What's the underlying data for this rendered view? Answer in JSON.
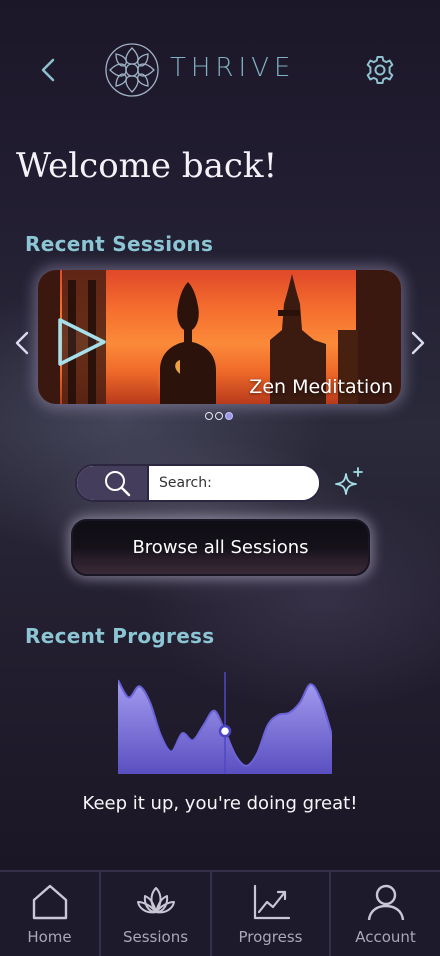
{
  "header": {
    "brand": "THRIVE",
    "back_icon": "chevron-left-icon",
    "logo_icon": "lotus-mandala-icon",
    "settings_icon": "gear-icon"
  },
  "welcome": {
    "title": "Welcome back!"
  },
  "recent_sessions": {
    "title": "Recent Sessions",
    "current": {
      "name": "Zen Meditation",
      "icon": "play-icon"
    },
    "pager": {
      "total": 3,
      "active": 3
    }
  },
  "search": {
    "placeholder": "Search:",
    "value": "",
    "icon": "search-icon",
    "assist_icon": "sparkle-icon"
  },
  "browse": {
    "label": "Browse all Sessions"
  },
  "recent_progress": {
    "title": "Recent Progress",
    "message": "Keep it up, you're doing great!"
  },
  "chart_data": {
    "type": "area",
    "title": "",
    "xlabel": "",
    "ylabel": "",
    "x": [
      0,
      1,
      2,
      3,
      4,
      5,
      6,
      7,
      8,
      9,
      10,
      11,
      12,
      13,
      14,
      15,
      16,
      17,
      18,
      19,
      20
    ],
    "values": [
      92,
      75,
      86,
      70,
      38,
      22,
      40,
      33,
      48,
      62,
      42,
      18,
      8,
      20,
      48,
      58,
      60,
      70,
      88,
      72,
      38
    ],
    "ylim": [
      0,
      100
    ],
    "highlight_index": 10,
    "grid": false,
    "fill_color": "#8d84e0",
    "line_color": "#6b63d8"
  },
  "bottom_nav": {
    "items": [
      {
        "label": "Home",
        "icon": "home-icon"
      },
      {
        "label": "Sessions",
        "icon": "lotus-icon"
      },
      {
        "label": "Progress",
        "icon": "trend-chart-icon"
      },
      {
        "label": "Account",
        "icon": "user-icon"
      }
    ]
  },
  "colors": {
    "accent": "#8cc6d4",
    "brand": "#7fb2c2",
    "nav_bg": "#1d1a2c",
    "chart_fill": "#8d84e0"
  }
}
